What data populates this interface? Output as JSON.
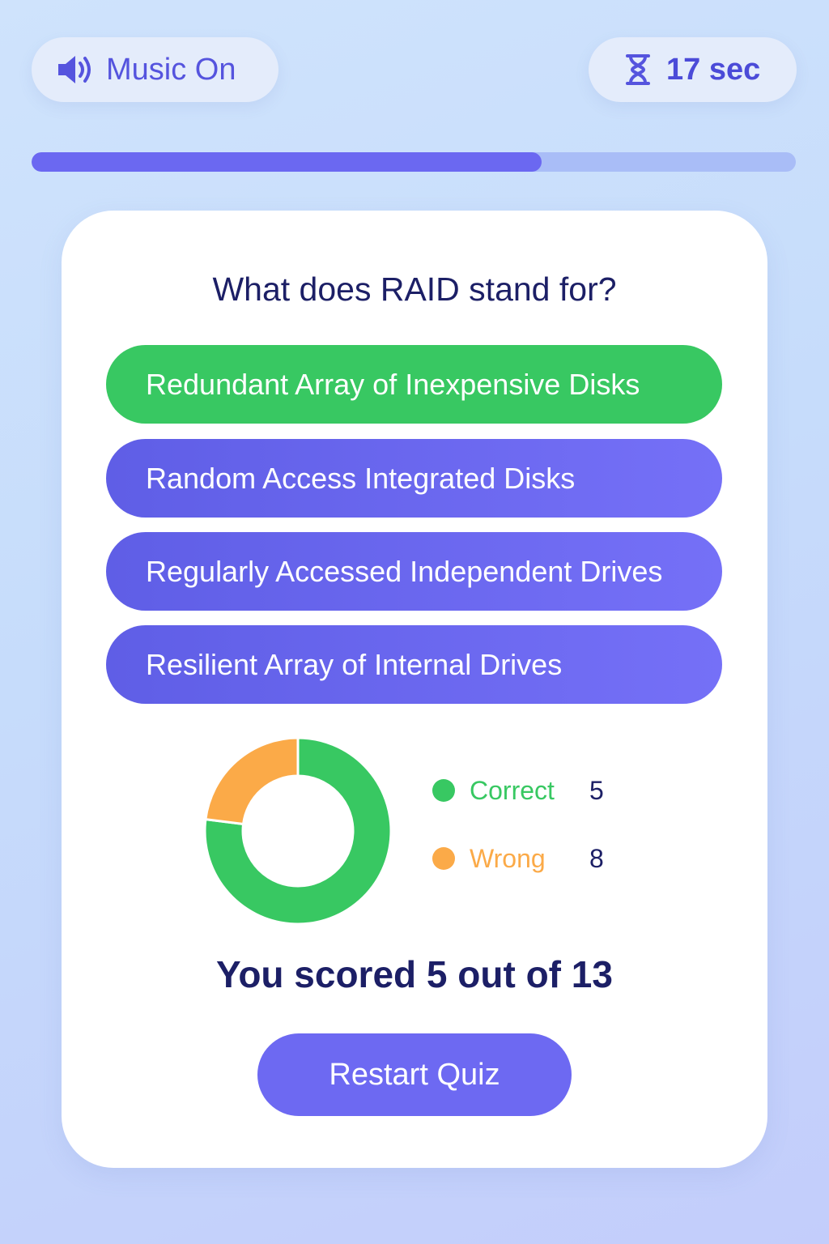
{
  "header": {
    "music_label": "Music On",
    "music_icon": "speaker-icon",
    "timer_label": "17 sec",
    "timer_icon": "hourglass-icon"
  },
  "progress": {
    "fraction": 0.667
  },
  "question": {
    "text": "What does RAID stand for?",
    "options": [
      {
        "label": "Redundant Array of Inexpensive Disks",
        "state": "correct"
      },
      {
        "label": "Random Access Integrated Disks",
        "state": "default"
      },
      {
        "label": "Regularly Accessed Independent Drives",
        "state": "default"
      },
      {
        "label": "Resilient Array of Internal Drives",
        "state": "default"
      }
    ]
  },
  "results": {
    "legend": [
      {
        "label": "Correct",
        "value": "5",
        "color": "#38c862"
      },
      {
        "label": "Wrong",
        "value": "8",
        "color": "#fbaa48"
      }
    ],
    "score_text": "You scored 5 out of 13",
    "restart_label": "Restart Quiz"
  },
  "chart_data": {
    "type": "pie",
    "categories": [
      "Correct",
      "Wrong"
    ],
    "values": [
      5,
      8
    ],
    "displayed_fractions": [
      0.77,
      0.23
    ],
    "colors": [
      "#38c862",
      "#fbaa48"
    ],
    "style": "donut"
  },
  "colors": {
    "accent": "#6b68f1",
    "correct": "#38c862",
    "wrong": "#fbaa48",
    "text_dark": "#1c1f66"
  }
}
